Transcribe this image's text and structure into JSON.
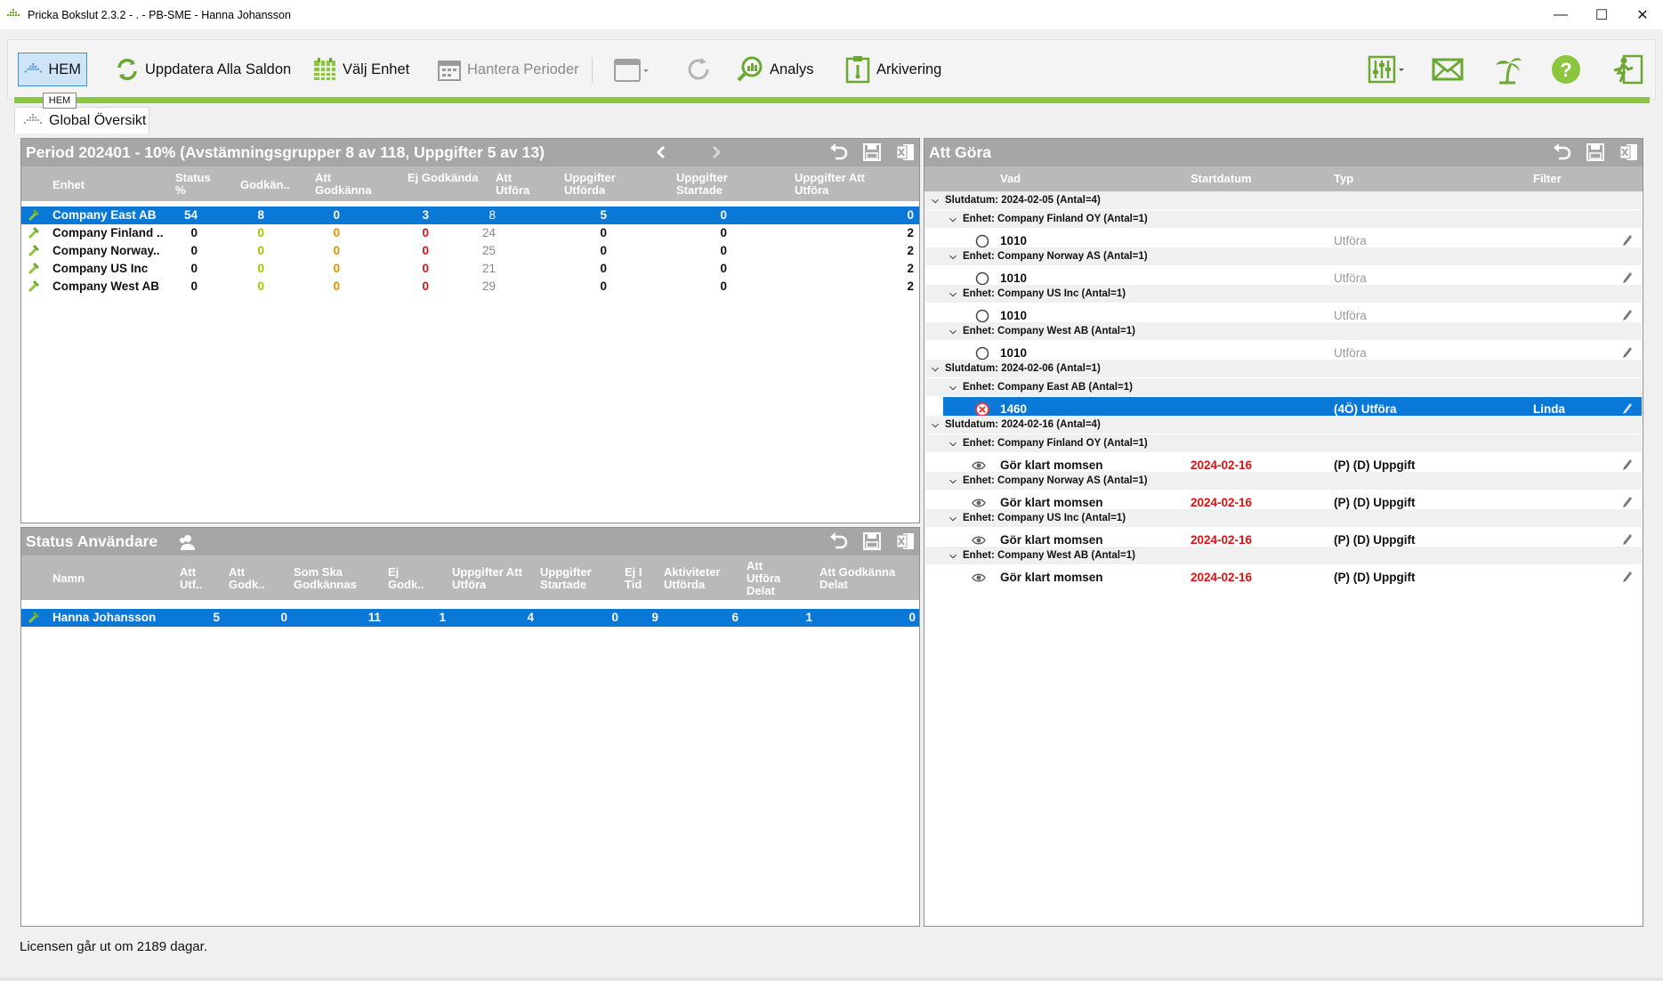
{
  "window": {
    "title": "Pricka Bokslut 2.3.2  - . - PB-SME - Hanna Johansson",
    "minimize": "—",
    "maximize": "☐",
    "close": "✕"
  },
  "toolbar": {
    "hem": "HEM",
    "uppdatera": "Uppdatera Alla Saldon",
    "valj_enhet": "Välj Enhet",
    "hantera_perioder": "Hantera Perioder",
    "analys": "Analys",
    "arkivering": "Arkivering",
    "tooltip": "HEM"
  },
  "tab": {
    "label": "Global Översikt"
  },
  "period_panel": {
    "title": "Period 202401 - 10% (Avstämningsgrupper 8 av 118, Uppgifter 5 av 13)",
    "columns": [
      "Enhet",
      "Status %",
      "Godkän..",
      "Att Godkänna",
      "Ej Godkända",
      "Att Utföra",
      "Uppgifter Utförda",
      "Uppgifter Startade",
      "Uppgifter Att Utföra"
    ],
    "rows": [
      {
        "enhet": "Company East AB",
        "status": "54",
        "godkan": "8",
        "att_godkanna": "0",
        "ej_godkanda": "3",
        "att_utfora": "8",
        "upp_utforda": "5",
        "upp_startade": "0",
        "upp_att_utfora": "0"
      },
      {
        "enhet": "Company Finland ..",
        "status": "0",
        "godkan": "0",
        "att_godkanna": "0",
        "ej_godkanda": "0",
        "att_utfora": "24",
        "upp_utforda": "0",
        "upp_startade": "0",
        "upp_att_utfora": "2"
      },
      {
        "enhet": "Company Norway..",
        "status": "0",
        "godkan": "0",
        "att_godkanna": "0",
        "ej_godkanda": "0",
        "att_utfora": "25",
        "upp_utforda": "0",
        "upp_startade": "0",
        "upp_att_utfora": "2"
      },
      {
        "enhet": "Company US Inc",
        "status": "0",
        "godkan": "0",
        "att_godkanna": "0",
        "ej_godkanda": "0",
        "att_utfora": "21",
        "upp_utforda": "0",
        "upp_startade": "0",
        "upp_att_utfora": "2"
      },
      {
        "enhet": "Company West AB",
        "status": "0",
        "godkan": "0",
        "att_godkanna": "0",
        "ej_godkanda": "0",
        "att_utfora": "29",
        "upp_utforda": "0",
        "upp_startade": "0",
        "upp_att_utfora": "2"
      }
    ]
  },
  "status_panel": {
    "title": "Status Användare",
    "columns": [
      "Namn",
      "Att Utf..",
      "Att Godk..",
      "Som Ska Godkännas",
      "Ej Godk..",
      "Uppgifter Att Utföra",
      "Uppgifter Startade",
      "Ej I Tid",
      "Aktiviteter Utförda",
      "Att Utföra Delat",
      "Att Godkänna Delat"
    ],
    "rows": [
      {
        "namn": "Hanna Johansson",
        "v1": "5",
        "v2": "0",
        "v3": "11",
        "v4": "1",
        "v5": "4",
        "v6": "0",
        "v7": "9",
        "v8": "6",
        "v9": "1",
        "v10": "0"
      }
    ]
  },
  "todo_panel": {
    "title": "Att Göra",
    "columns": [
      "Vad",
      "Startdatum",
      "Typ",
      "Filter"
    ],
    "groups": [
      "Slutdatum: 2024-02-05 (Antal=4)",
      "Enhet: Company Finland OY (Antal=1)",
      "Enhet: Company Norway AS (Antal=1)",
      "Enhet: Company US Inc (Antal=1)",
      "Enhet: Company West AB (Antal=1)",
      "Slutdatum: 2024-02-06 (Antal=1)",
      "Enhet: Company East AB (Antal=1)",
      "Slutdatum: 2024-02-16 (Antal=4)",
      "Enhet: Company Finland OY (Antal=1)",
      "Enhet: Company Norway AS (Antal=1)",
      "Enhet: Company US Inc (Antal=1)",
      "Enhet: Company West AB (Antal=1)"
    ],
    "items": [
      {
        "vad": "1010",
        "start": "",
        "typ": "Utföra",
        "filter": ""
      },
      {
        "vad": "1010",
        "start": "",
        "typ": "Utföra",
        "filter": ""
      },
      {
        "vad": "1010",
        "start": "",
        "typ": "Utföra",
        "filter": ""
      },
      {
        "vad": "1010",
        "start": "",
        "typ": "Utföra",
        "filter": ""
      },
      {
        "vad": "1460",
        "start": "",
        "typ": "(4Ö) Utföra",
        "filter": "Linda"
      },
      {
        "vad": "Gör klart momsen",
        "start": "2024-02-16",
        "typ": "(P) (D) Uppgift",
        "filter": ""
      },
      {
        "vad": "Gör klart momsen",
        "start": "2024-02-16",
        "typ": "(P) (D) Uppgift",
        "filter": ""
      },
      {
        "vad": "Gör klart momsen",
        "start": "2024-02-16",
        "typ": "(P) (D) Uppgift",
        "filter": ""
      },
      {
        "vad": "Gör klart momsen",
        "start": "2024-02-16",
        "typ": "(P) (D) Uppgift",
        "filter": ""
      }
    ]
  },
  "footer": {
    "license": "Licensen går ut om 2189 dagar."
  },
  "colors": {
    "accent": "#8cc63f",
    "selection": "#0a78d7",
    "header": "#a6a6a6",
    "red": "#e01010",
    "orange": "#f08c00",
    "yellow": "#a7c400"
  }
}
